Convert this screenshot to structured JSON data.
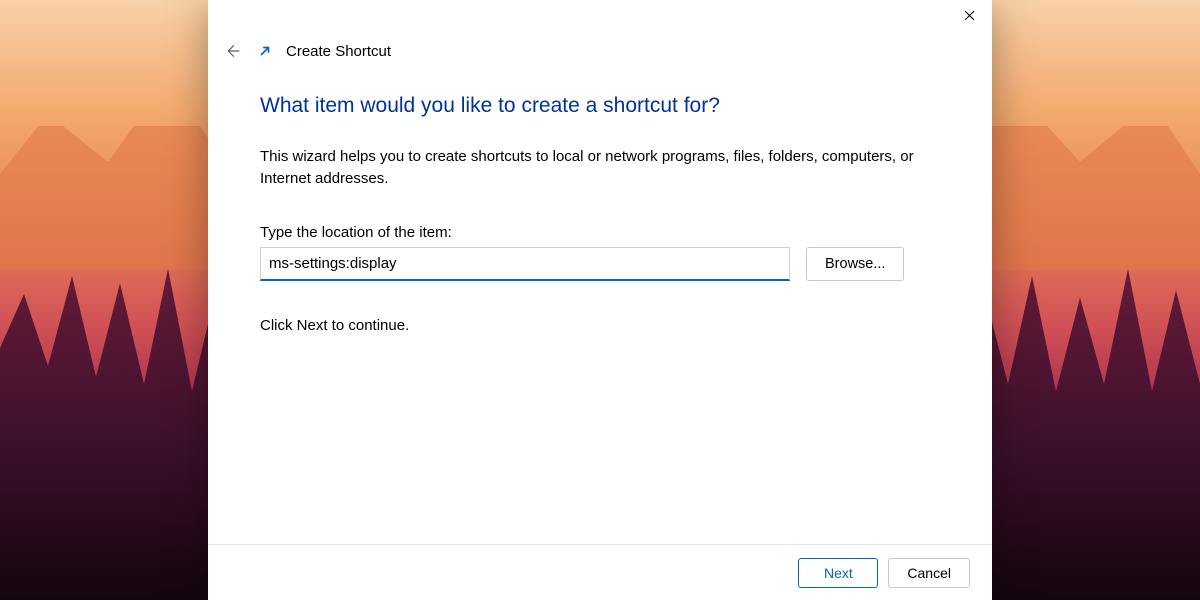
{
  "header": {
    "title": "Create Shortcut"
  },
  "content": {
    "heading": "What item would you like to create a shortcut for?",
    "description": "This wizard helps you to create shortcuts to local or network programs, files, folders, computers, or Internet addresses.",
    "field_label": "Type the location of the item:",
    "location_value": "ms-settings:display",
    "browse_label": "Browse...",
    "hint": "Click Next to continue."
  },
  "footer": {
    "next_label": "Next",
    "cancel_label": "Cancel"
  }
}
